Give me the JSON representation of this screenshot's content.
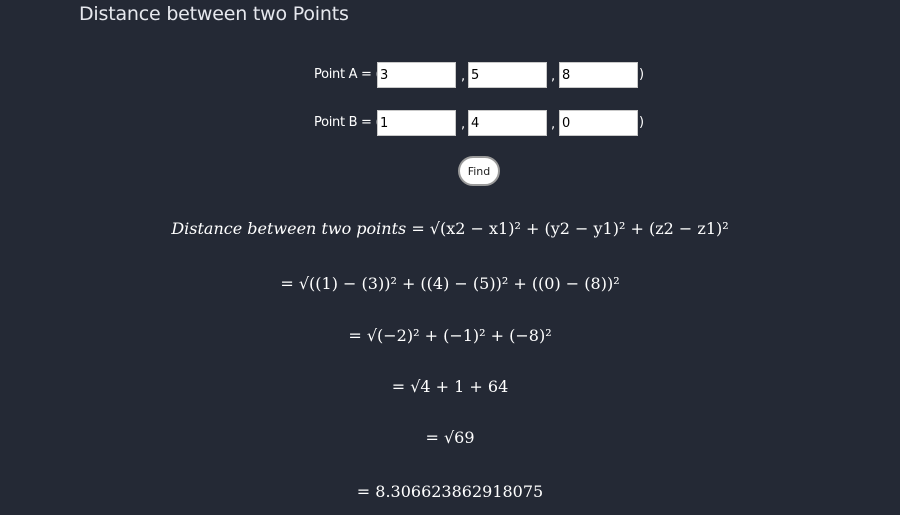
{
  "app": {
    "title": "Distance between two Points"
  },
  "point_a": {
    "label": "Point A = (",
    "x": "3",
    "y": "5",
    "z": "8",
    "sep": ",",
    "close": ")"
  },
  "point_b": {
    "label": "Point B = (",
    "x": "1",
    "y": "4",
    "z": "0",
    "sep": ",",
    "close": ")"
  },
  "find_button": {
    "label": "Find"
  },
  "result": {
    "formula_lhs": "Distance between two points",
    "formula_rhs": "= √(x2 − x1)² + (y2 − y1)² + (z2 − z1)²",
    "step1": "= √((1) − (3))² + ((4) − (5))² + ((0) − (8))²",
    "step2": "= √(−2)² + (−1)² + (−8)²",
    "step3": "= √4 + 1 + 64",
    "step4": "= √69",
    "step5": "= 8.306623862918075"
  }
}
